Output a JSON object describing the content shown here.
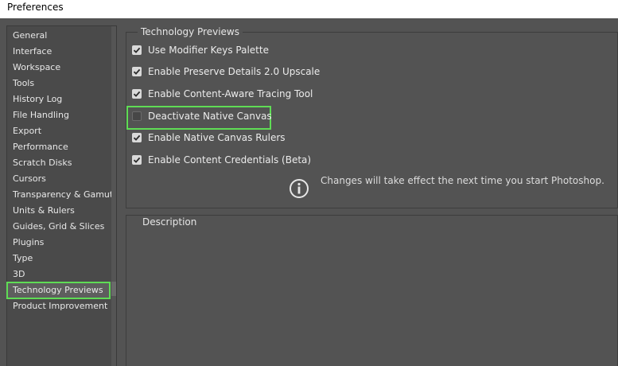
{
  "window": {
    "title": "Preferences"
  },
  "sidebar": {
    "items": [
      {
        "label": "General"
      },
      {
        "label": "Interface"
      },
      {
        "label": "Workspace"
      },
      {
        "label": "Tools"
      },
      {
        "label": "History Log"
      },
      {
        "label": "File Handling"
      },
      {
        "label": "Export"
      },
      {
        "label": "Performance"
      },
      {
        "label": "Scratch Disks"
      },
      {
        "label": "Cursors"
      },
      {
        "label": "Transparency & Gamut"
      },
      {
        "label": "Units & Rulers"
      },
      {
        "label": "Guides, Grid & Slices"
      },
      {
        "label": "Plugins"
      },
      {
        "label": "Type"
      },
      {
        "label": "3D"
      },
      {
        "label": "Technology Previews",
        "selected": true
      },
      {
        "label": "Product Improvement"
      }
    ]
  },
  "tech_previews": {
    "title": "Technology Previews",
    "options": [
      {
        "label": "Use Modifier Keys Palette",
        "checked": true
      },
      {
        "label": "Enable Preserve Details 2.0 Upscale",
        "checked": true
      },
      {
        "label": "Enable Content-Aware Tracing Tool",
        "checked": true
      },
      {
        "label": "Deactivate Native Canvas",
        "checked": false
      },
      {
        "label": "Enable Native Canvas Rulers",
        "checked": true
      },
      {
        "label": "Enable Content Credentials (Beta)",
        "checked": true
      }
    ],
    "info_text": "Changes will take effect the next time you start Photoshop.",
    "info_icon": "info-circle-icon"
  },
  "description": {
    "title": "Description"
  },
  "colors": {
    "highlight": "#5fdc55",
    "panel_bg": "#535353"
  }
}
